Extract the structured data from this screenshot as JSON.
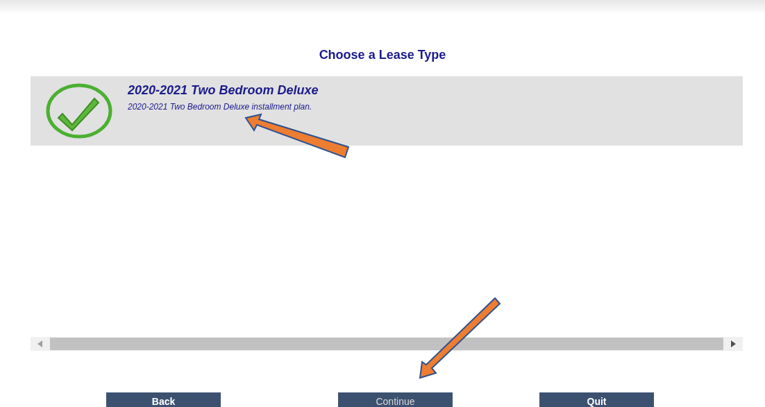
{
  "heading": "Choose a Lease Type",
  "lease_options": [
    {
      "title": "2020-2021 Two Bedroom Deluxe",
      "description": "2020-2021 Two Bedroom Deluxe installment plan.",
      "selected": true
    }
  ],
  "buttons": [
    {
      "label": "Back",
      "disabled": false
    },
    {
      "label": "Continue",
      "disabled": true
    },
    {
      "label": "Quit",
      "disabled": false
    }
  ]
}
